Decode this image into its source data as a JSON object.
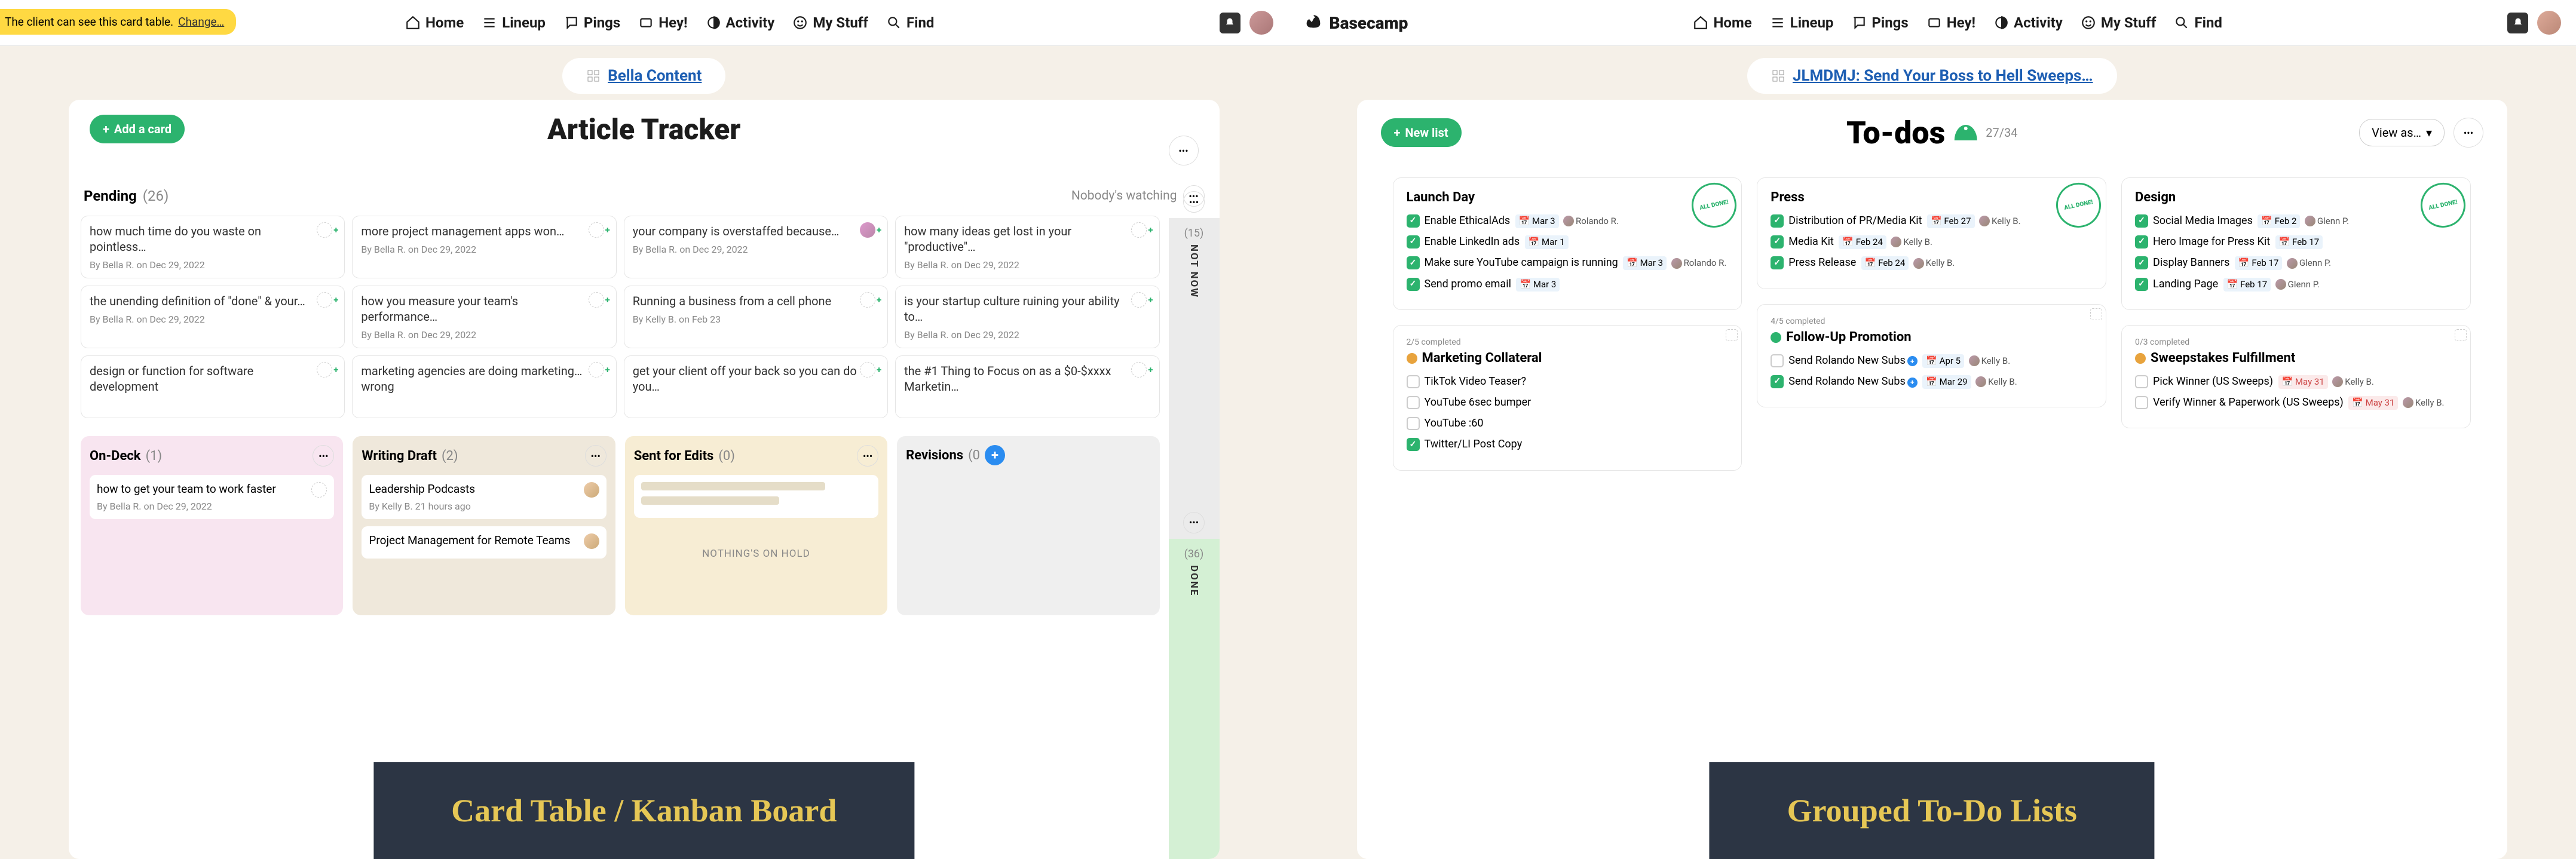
{
  "app": "Basecamp",
  "nav": [
    "Home",
    "Lineup",
    "Pings",
    "Hey!",
    "Activity",
    "My Stuff",
    "Find"
  ],
  "left": {
    "project": "Bella Content",
    "notice": "The client can see this card table.",
    "notice_link": "Change…",
    "add_card": "Add a card",
    "title": "Article Tracker",
    "pending_label": "Pending",
    "pending_count": "(26)",
    "watching": "Nobody's watching",
    "rail_notnow_count": "(15)",
    "rail_notnow_label": "NOT NOW",
    "rail_done_count": "(36)",
    "rail_done_label": "DONE",
    "cards": [
      [
        {
          "t": "how much time do you waste on pointless…",
          "m": "By Bella R. on Dec 29, 2022",
          "ghost": true
        },
        {
          "t": "the unending definition of \"done\" & your…",
          "m": "By Bella R. on Dec 29, 2022",
          "ghost": true
        },
        {
          "t": "design or function for software development",
          "m": "",
          "ghost": true
        }
      ],
      [
        {
          "t": "more project management apps won…",
          "m": "By Bella R. on Dec 29, 2022",
          "ghost": true
        },
        {
          "t": "how you measure your team's performance…",
          "m": "By Bella R. on Dec 29, 2022",
          "ghost": true
        },
        {
          "t": "marketing agencies are doing marketing…wrong",
          "m": "",
          "ghost": true
        }
      ],
      [
        {
          "t": "your company is overstaffed because…",
          "m": "By Bella R. on Dec 29, 2022",
          "ghost": false
        },
        {
          "t": "Running a business from a cell phone",
          "m": "By Kelly B. on Feb 23",
          "ghost": true
        },
        {
          "t": "get your client off your back so you can do you…",
          "m": "",
          "ghost": true
        }
      ],
      [
        {
          "t": "how many ideas get lost in your \"productive\"…",
          "m": "By Bella R. on Dec 29, 2022",
          "ghost": true
        },
        {
          "t": "is your startup culture ruining your ability to…",
          "m": "By Bella R. on Dec 29, 2022",
          "ghost": true
        },
        {
          "t": "the #1 Thing to Focus on as a $0-$xxxx Marketin…",
          "m": "",
          "ghost": true
        }
      ]
    ],
    "stages": [
      {
        "name": "On-Deck",
        "count": "(1)",
        "class": "pink",
        "cards": [
          {
            "t": "how to get your team to work faster",
            "m": "By Bella R. on Dec 29, 2022",
            "ghost": true
          }
        ]
      },
      {
        "name": "Writing Draft",
        "count": "(2)",
        "class": "tan",
        "cards": [
          {
            "t": "Leadership Podcasts",
            "m": "By Kelly B. 21 hours ago",
            "ghost": false
          },
          {
            "t": "Project Management for Remote Teams",
            "m": "",
            "ghost": false
          }
        ]
      },
      {
        "name": "Sent for Edits",
        "count": "(0)",
        "class": "yel",
        "hold": "NOTHING'S ON HOLD",
        "skel": true
      },
      {
        "name": "Revisions",
        "count": "(0",
        "class": "gry",
        "plus": true
      }
    ],
    "caption": "Card Table / Kanban Board"
  },
  "right": {
    "project": "JLMDMJ: Send Your Boss to Hell Sweeps…",
    "newlist": "New list",
    "title": "To-dos",
    "count": "27/34",
    "viewas": "View as…",
    "caption": "Grouped To-Do Lists",
    "lists": [
      {
        "name": "Launch Day",
        "stamp": "ALL DONE!",
        "items": [
          {
            "done": true,
            "t": "Enable EthicalAds",
            "dt": "Mar 3",
            "a": "Rolando R."
          },
          {
            "done": true,
            "t": "Enable LinkedIn ads",
            "dt": "Mar 1",
            "a": ""
          },
          {
            "done": true,
            "t": "Make sure YouTube campaign is running",
            "dt": "Mar 3",
            "a": "Rolando R."
          },
          {
            "done": true,
            "t": "Send promo email",
            "dt": "Mar 3",
            "a": ""
          }
        ]
      },
      {
        "name": "Press",
        "stamp": "ALL DONE!",
        "items": [
          {
            "done": true,
            "t": "Distribution of PR/Media Kit",
            "dt": "Feb 27",
            "a": "Kelly B."
          },
          {
            "done": true,
            "t": "Media Kit",
            "dt": "Feb 24",
            "a": "Kelly B."
          },
          {
            "done": true,
            "t": "Press Release",
            "dt": "Feb 24",
            "a": "Kelly B."
          }
        ]
      },
      {
        "name": "Design",
        "stamp": "ALL DONE!",
        "items": [
          {
            "done": true,
            "t": "Social Media Images",
            "dt": "Feb 2",
            "a": "Glenn P."
          },
          {
            "done": true,
            "t": "Hero Image for Press Kit",
            "dt": "Feb 17",
            "a": ""
          },
          {
            "done": true,
            "t": "Display Banners",
            "dt": "Feb 17",
            "a": "Glenn P."
          },
          {
            "done": true,
            "t": "Landing Page",
            "dt": "Feb 17",
            "a": "Glenn P."
          }
        ]
      },
      {
        "name": "Marketing Collateral",
        "prog": "2/5 completed",
        "dot": "o",
        "items": [
          {
            "done": false,
            "t": "TikTok Video Teaser?"
          },
          {
            "done": false,
            "t": "YouTube 6sec bumper"
          },
          {
            "done": false,
            "t": "YouTube :60"
          },
          {
            "done": true,
            "t": "Twitter/LI Post Copy"
          }
        ]
      },
      {
        "name": "Follow-Up Promotion",
        "prog": "4/5 completed",
        "dot": "g",
        "items": [
          {
            "done": false,
            "t": "Send Rolando New Subs",
            "dt": "Apr 5",
            "a": "Kelly B.",
            "plus": true
          },
          {
            "done": true,
            "t": "Send Rolando New Subs",
            "dt": "Mar 29",
            "a": "Kelly B.",
            "plus": true
          }
        ]
      },
      {
        "name": "Sweepstakes Fulfillment",
        "prog": "0/3 completed",
        "dot": "o",
        "items": [
          {
            "done": false,
            "t": "Pick Winner (US Sweeps)",
            "dt": "May 31",
            "red": true,
            "a": "Kelly B."
          },
          {
            "done": false,
            "t": "Verify Winner & Paperwork (US Sweeps)",
            "dt": "May 31",
            "red": true,
            "a": "Kelly B."
          }
        ]
      }
    ]
  }
}
